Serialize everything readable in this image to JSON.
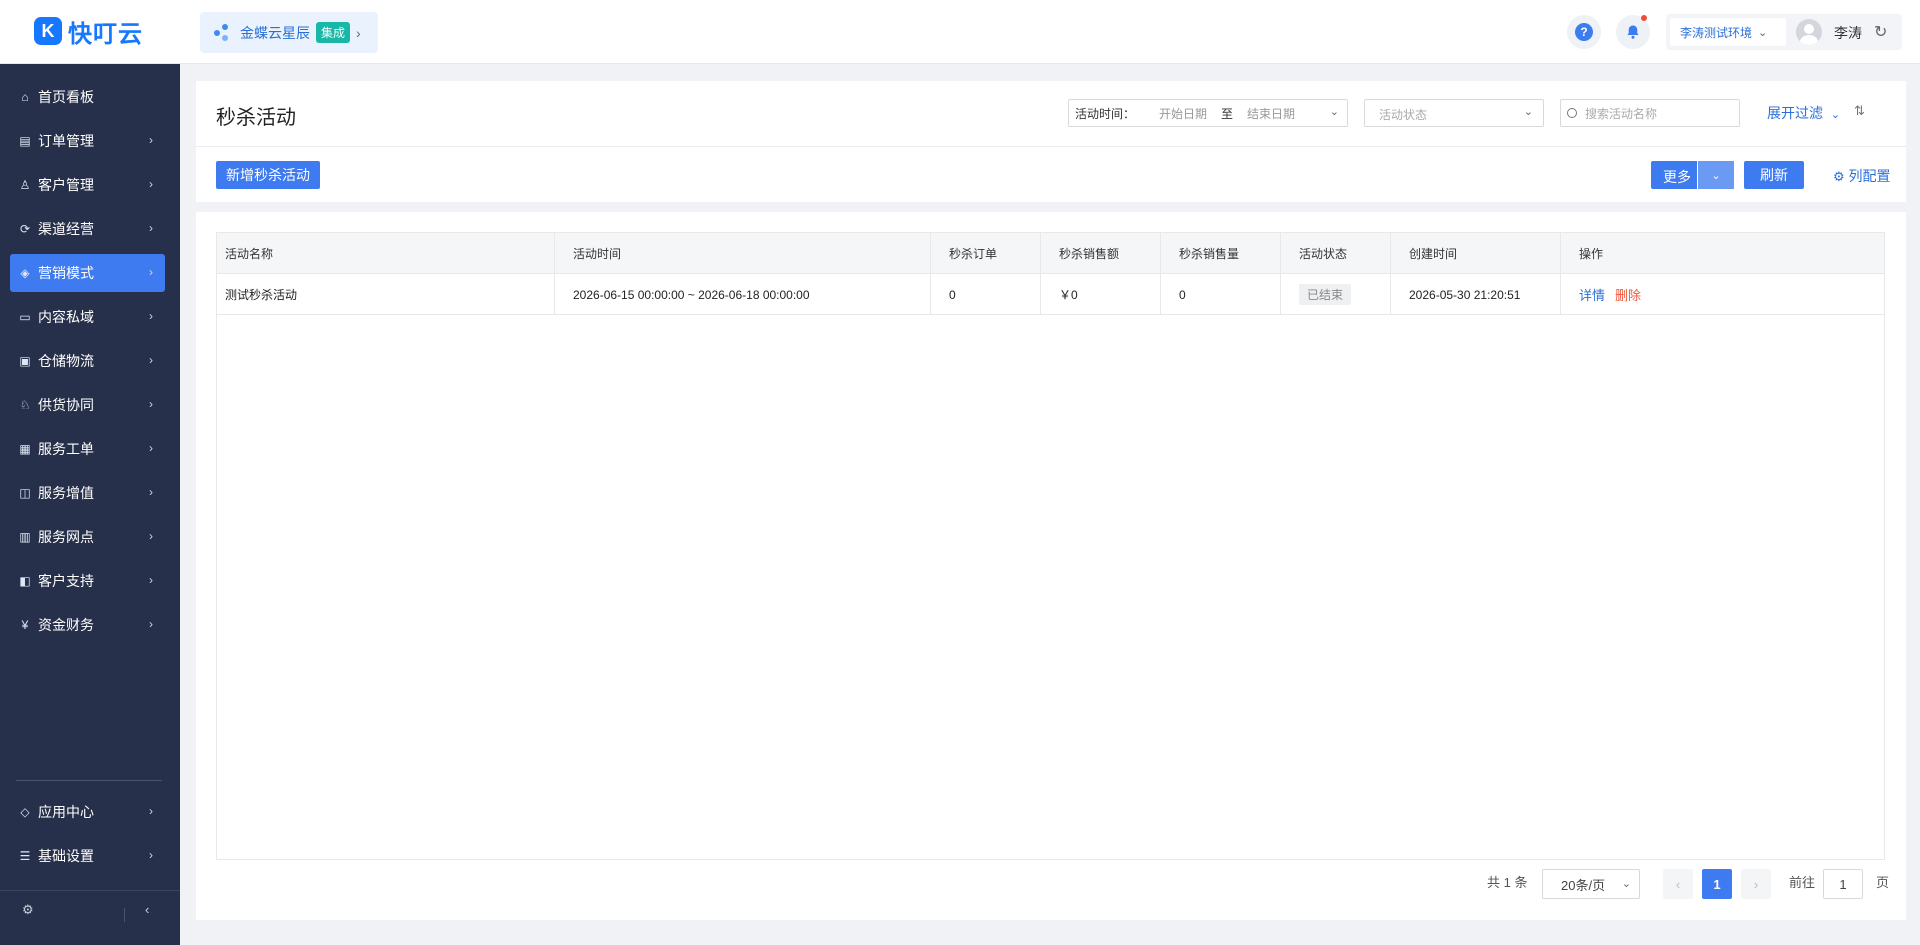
{
  "brand": {
    "logo_letter": "K",
    "name": "快叮云"
  },
  "product_switch": {
    "name": "金蝶云星辰",
    "tag": "集成"
  },
  "header": {
    "help_icon": "question-circle",
    "bell_icon": "bell",
    "environment": "李涛测试环境",
    "user": "李涛"
  },
  "sidebar": {
    "items": [
      {
        "label": "首页看板",
        "icon": "home-icon",
        "arrow": false
      },
      {
        "label": "订单管理",
        "icon": "clipboard-icon",
        "arrow": true
      },
      {
        "label": "客户管理",
        "icon": "user-icon",
        "arrow": true
      },
      {
        "label": "渠道经营",
        "icon": "channel-icon",
        "arrow": true
      },
      {
        "label": "营销模式",
        "icon": "tag-icon",
        "arrow": true,
        "active": true
      },
      {
        "label": "内容私域",
        "icon": "image-icon",
        "arrow": true
      },
      {
        "label": "仓储物流",
        "icon": "box-icon",
        "arrow": true
      },
      {
        "label": "供货协同",
        "icon": "supplier-icon",
        "arrow": true
      },
      {
        "label": "服务工单",
        "icon": "ticket-icon",
        "arrow": true
      },
      {
        "label": "服务增值",
        "icon": "bag-icon",
        "arrow": true
      },
      {
        "label": "服务网点",
        "icon": "store-icon",
        "arrow": true
      },
      {
        "label": "客户支持",
        "icon": "support-icon",
        "arrow": true
      },
      {
        "label": "资金财务",
        "icon": "yen-icon",
        "arrow": true
      }
    ],
    "bottom_items": [
      {
        "label": "应用中心",
        "icon": "cube-icon"
      },
      {
        "label": "基础设置",
        "icon": "settings-list-icon"
      }
    ]
  },
  "page": {
    "title": "秒杀活动",
    "filters": {
      "date_label": "活动时间：",
      "start_placeholder": "开始日期",
      "to": "至",
      "end_placeholder": "结束日期",
      "status_placeholder": "活动状态",
      "search_placeholder": "搜索活动名称",
      "expand": "展开过滤"
    },
    "actions": {
      "add": "新增秒杀活动",
      "more": "更多",
      "refresh": "刷新",
      "column_config": "列配置"
    }
  },
  "table": {
    "columns": [
      "活动名称",
      "活动时间",
      "秒杀订单",
      "秒杀销售额",
      "秒杀销售量",
      "活动状态",
      "创建时间",
      "操作"
    ],
    "rows": [
      {
        "name": "测试秒杀活动",
        "time": "2026-06-15 00:00:00 ~ 2026-06-18 00:00:00",
        "orders": "0",
        "sales_amount": "￥0",
        "sales_qty": "0",
        "status": "已结束",
        "created": "2026-05-30 21:20:51",
        "ops": [
          "详情",
          "删除"
        ]
      }
    ]
  },
  "pagination": {
    "total": "共 1 条",
    "page_size": "20条/页",
    "current": "1",
    "goto_label": "前往",
    "goto_value": "1",
    "page_suffix": "页"
  },
  "colors": {
    "primary": "#3f7bf0",
    "sidebar_bg": "#27304a",
    "danger": "#f0553a",
    "link": "#2a6fd8"
  }
}
